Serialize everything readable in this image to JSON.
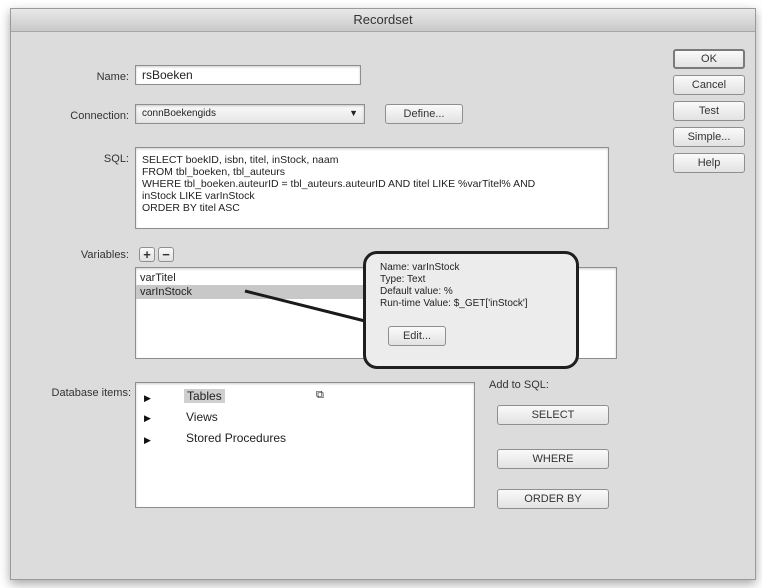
{
  "dialog": {
    "title": "Recordset"
  },
  "name": {
    "label": "Name:",
    "value": "rsBoeken"
  },
  "connection": {
    "label": "Connection:",
    "value": "connBoekengids",
    "define_label": "Define..."
  },
  "sql": {
    "label": "SQL:",
    "text": "SELECT boekID, isbn, titel, inStock, naam\nFROM tbl_boeken, tbl_auteurs\nWHERE tbl_boeken.auteurID = tbl_auteurs.auteurID AND titel LIKE %varTitel% AND\ninStock LIKE varInStock\nORDER BY titel ASC"
  },
  "variables": {
    "label": "Variables:",
    "add_label": "+",
    "remove_label": "−",
    "items": [
      "varTitel",
      "varInStock"
    ],
    "selected_index": 1
  },
  "popup": {
    "name": "Name: varInStock",
    "type": "Type: Text",
    "default": "Default value: %",
    "runtime": "Run-time Value: $_GET['inStock']",
    "edit_label": "Edit..."
  },
  "database_items": {
    "label": "Database items:",
    "tables": "Tables",
    "views": "Views",
    "procs": "Stored Procedures"
  },
  "add_to_sql": {
    "label": "Add to SQL:",
    "select": "SELECT",
    "where": "WHERE",
    "orderby": "ORDER BY"
  },
  "side_buttons": {
    "ok": "OK",
    "cancel": "Cancel",
    "test": "Test",
    "simple": "Simple...",
    "help": "Help"
  }
}
